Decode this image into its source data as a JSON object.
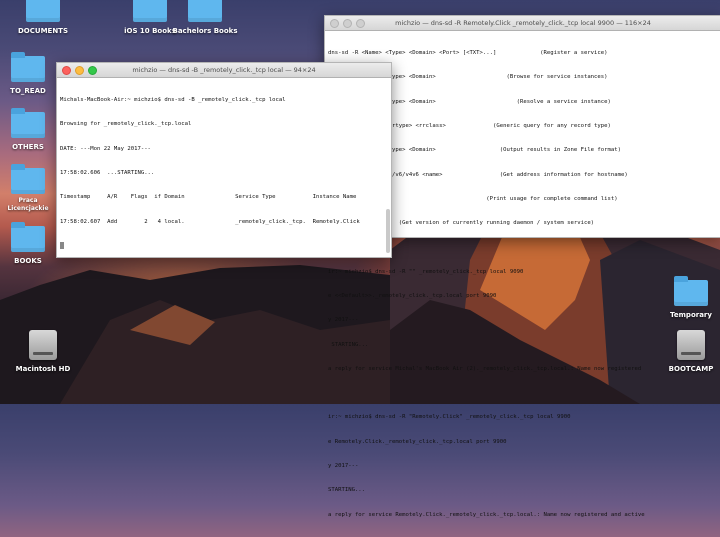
{
  "desktop": {
    "icons": [
      {
        "label": "DOCUMENTS"
      },
      {
        "label": "iOS 10 Books"
      },
      {
        "label": "Bachelors Books"
      },
      {
        "label": "TO_READ"
      },
      {
        "label": "OTHERS"
      },
      {
        "label": "Praca"
      },
      {
        "label": "Licencjackie"
      },
      {
        "label": "BOOKS"
      },
      {
        "label": "Macintosh HD"
      },
      {
        "label": "Temporary"
      },
      {
        "label": "BOOTCAMP"
      }
    ]
  },
  "terminal_back": {
    "title": "michzio — dns-sd -R Remotely.Click _remotely_click._tcp local 9900 — 116×24",
    "lines": [
      "dns-sd -R <Name> <Type> <Domain> <Port> [<TXT>...]             (Register a service)",
      "dns-sd -B        <Type> <Domain>                     (Browse for service instances)",
      "dns-sd -L <Name> <Type> <Domain>                        (Resolve a service instance)",
      "dns-sd -Q <name> <rrtype> <rrclass>              (Generic query for any record type)",
      "dns-sd -Z        <Type> <Domain>                   (Output results in Zone File format)",
      "dns-sd -G        v4/v6/v4v6 <name>                 (Get address information for hostname)",
      "                                               (Print usage for complete command list)",
      "                     (Get version of currently running daemon / system service)",
      "ir:~ michzio$",
      "ir:~ michzio$ dns-sd -R \"\" _remotely_click._tcp local 9090",
      "e <<Default>>._remotely_click._tcp.local port 9090",
      "y 2017---",
      " STARTING...",
      "a reply for service Michal's MacBook Air (2)._remotely_click._tcp.local.: Name now registered",
      "",
      "ir:~ michzio$ dns-sd -R \"Remotely.Click\" _remotely_click._tcp local 9900",
      "e Remotely.Click._remotely_click._tcp.local port 9900",
      "y 2017---",
      "STARTING...",
      "a reply for service Remotely.Click._remotely_click._tcp.local.: Name now registered and active"
    ]
  },
  "terminal_front": {
    "title": "michzio — dns-sd -B _remotely_click._tcp local — 94×24",
    "lines": [
      "Michals-MacBook-Air:~ michzio$ dns-sd -B _remotely_click._tcp local",
      "Browsing for _remotely_click._tcp.local",
      "DATE: ---Mon 22 May 2017---",
      "17:58:02.606  ...STARTING...",
      "Timestamp     A/R    Flags  if Domain               Service Type           Instance Name",
      "17:58:02.607  Add        2   4 local.               _remotely_click._tcp.  Remotely.Click"
    ]
  }
}
